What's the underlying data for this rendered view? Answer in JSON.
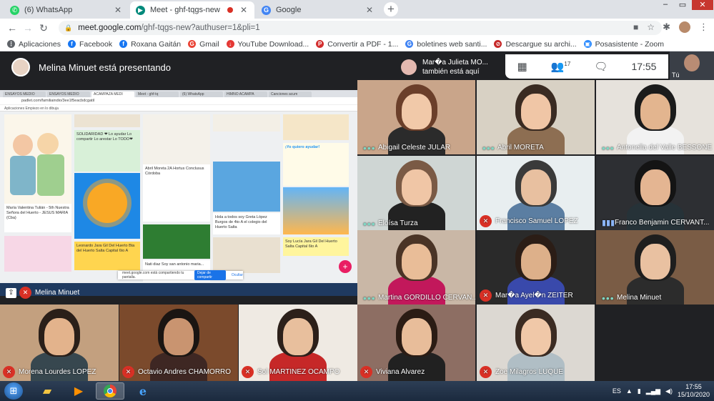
{
  "browser": {
    "tabs": [
      {
        "label": "(6) WhatsApp",
        "icon": "whatsapp-icon",
        "color": "#25d366",
        "glyph": "✆"
      },
      {
        "label": "Meet - ghf-tqgs-new",
        "icon": "meet-icon",
        "color": "#00897b",
        "glyph": "▶",
        "recording": true
      },
      {
        "label": "Google",
        "icon": "google-icon",
        "color": "#4285f4",
        "glyph": "G"
      }
    ],
    "url_host": "meet.google.com",
    "url_path": "/ghf-tqgs-new?authuser=1&pli=1",
    "bookmarks": [
      {
        "label": "Aplicaciones",
        "icon": "apps-grid-icon",
        "color": "#5f6368",
        "glyph": "⋮"
      },
      {
        "label": "Facebook",
        "icon": "facebook-icon",
        "color": "#1877f2",
        "glyph": "f"
      },
      {
        "label": "Roxana Gaitán",
        "icon": "facebook-icon",
        "color": "#1877f2",
        "glyph": "f"
      },
      {
        "label": "Gmail",
        "icon": "google-icon",
        "color": "#ea4335",
        "glyph": "G"
      },
      {
        "label": "YouTube Download...",
        "icon": "download-icon",
        "color": "#e53935",
        "glyph": "↓"
      },
      {
        "label": "Convertir a PDF - 1...",
        "icon": "pdf-icon",
        "color": "#d32f2f",
        "glyph": "P"
      },
      {
        "label": "boletines web santi...",
        "icon": "google-icon",
        "color": "#4285f4",
        "glyph": "G"
      },
      {
        "label": "Descargue su archi...",
        "icon": "block-icon",
        "color": "#c62828",
        "glyph": "⊘"
      },
      {
        "label": "Posasistente - Zoom",
        "icon": "zoom-icon",
        "color": "#2d8cff",
        "glyph": "▣"
      }
    ]
  },
  "meet": {
    "presenting_text": "Melina Minuet está presentando",
    "also_here_name": "Mar�a Julieta MO...",
    "also_here_sub": "también está aquí",
    "participants_count": "17",
    "time": "17:55",
    "self_label": "Tú",
    "presenter_tile_name": "Melina Minuet",
    "shared_screen": {
      "tabs": [
        "ENSAYOS MEDIO",
        "ENSAYOS MEDIO",
        "ACAMPAZA MEDI",
        "Meet - ghf-tq",
        "(6) WhatsApp",
        "HIMNO ACAMPA",
        "Canciones acum"
      ],
      "url": "padlet.com/familiaindio/3ee1f5eacbdcgatil",
      "bookmarks": "Aplicaciones   Empiezo en lo dibuja",
      "cards": [
        "María Valentina Tulián - 5th Nuestra Señora del Huerto - JESUS MARIA (Cba)",
        "SOLIDARIDAD ❤ Lo ayudar Lo compartir Lo arestar Lo TODO❤",
        "Abril Moreta 2A Hortus Conclusus Córdoba",
        "¡Yo quiero ayudar!",
        "Hola a todos soy Greta López Burgos de 4to A el colegio del Huerto Salta",
        "Nati diaz Soy san antonio maria...",
        "Soy Lucía Jara Gil Del Huerto Salta Capital 6to A",
        "Leonardo Jara Gil Del Huerto Bta del Huerto Salta Capital 6to A"
      ],
      "toast": "meet.google.com está compartiendo tu pantalla.",
      "toast_btn": "Dejar de compartir",
      "toast_hide": "Ocultar"
    },
    "participants": [
      {
        "name": "Abigail Celeste JULAR",
        "status": "dots"
      },
      {
        "name": "Abril MORETA",
        "status": "dots"
      },
      {
        "name": "Antonella del Valle BESSONE",
        "status": "dots"
      },
      {
        "name": "Eloísa Turza",
        "status": "dots"
      },
      {
        "name": "Francisco Samuel LOPEZ",
        "status": "muted"
      },
      {
        "name": "Franco Benjamin CERVANT...",
        "status": "speaking"
      },
      {
        "name": "Martina GORDILLO CERVAN...",
        "status": "dots"
      },
      {
        "name": "Mar�a Ayel�n ZEITER",
        "status": "muted"
      },
      {
        "name": "Melina Minuet",
        "status": "dots"
      },
      {
        "name": "Morena Lourdes LOPEZ",
        "status": "muted"
      },
      {
        "name": "Octavio Andres CHAMORRO",
        "status": "muted"
      },
      {
        "name": "Sol MARTINEZ OCAMPO",
        "status": "muted"
      },
      {
        "name": "Viviana Alvarez",
        "status": "muted"
      },
      {
        "name": "Zoe Milagros LUQUE",
        "status": "muted"
      }
    ]
  },
  "taskbar": {
    "apps": [
      {
        "icon": "file-explorer-icon",
        "glyph": "📁"
      },
      {
        "icon": "media-player-icon",
        "glyph": "▶"
      },
      {
        "icon": "chrome-icon",
        "glyph": "◉"
      },
      {
        "icon": "internet-explorer-icon",
        "glyph": "e"
      }
    ],
    "lang": "ES",
    "clock_time": "17:55",
    "clock_date": "15/10/2020"
  }
}
